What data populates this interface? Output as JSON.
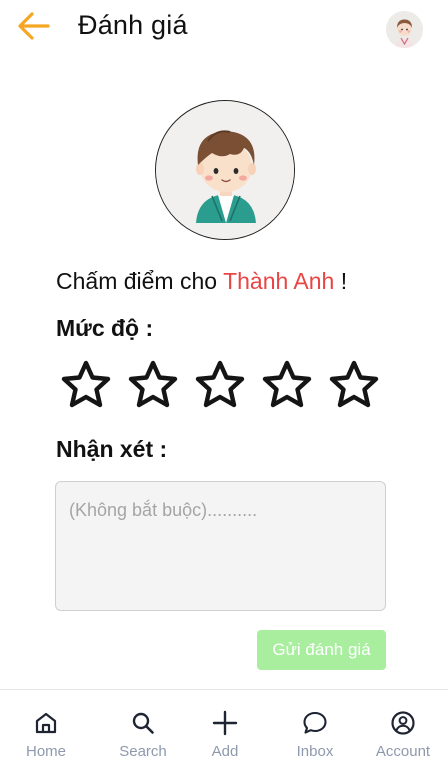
{
  "header": {
    "title": "Đánh giá",
    "back_icon": "arrow-left-icon",
    "accent_color": "#f5a623"
  },
  "rating": {
    "prompt_prefix": "Chấm điểm cho",
    "target_name": "Thành Anh",
    "prompt_suffix": "!",
    "level_label": "Mức độ :",
    "stars_selected": 0,
    "stars_total": 5,
    "comment_label": "Nhận xét :",
    "comment_placeholder": "(Không bắt buộc)..........",
    "comment_value": "",
    "submit_label": "Gửi đánh giá",
    "submit_color": "#a9ee9f",
    "name_color": "#e84545"
  },
  "nav": {
    "items": [
      {
        "label": "Home",
        "icon": "home-icon"
      },
      {
        "label": "Search",
        "icon": "search-icon"
      },
      {
        "label": "Add",
        "icon": "plus-icon"
      },
      {
        "label": "Inbox",
        "icon": "chat-bubble-icon"
      },
      {
        "label": "Account",
        "icon": "account-icon"
      }
    ]
  }
}
